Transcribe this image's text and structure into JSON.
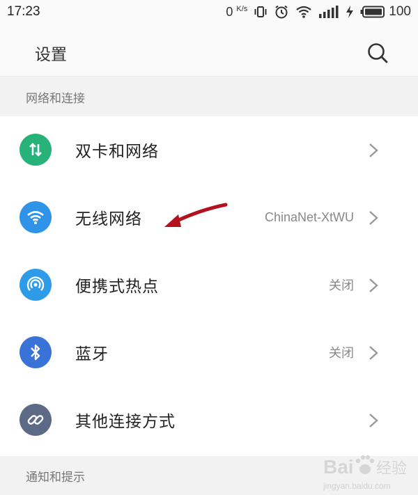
{
  "status_bar": {
    "time": "17:23",
    "net_speed": "0",
    "net_speed_unit": "K/s",
    "battery_level": "100"
  },
  "header": {
    "title": "设置",
    "search_icon": "search-icon"
  },
  "sections": {
    "network": "网络和连接",
    "notifications": "通知和提示"
  },
  "items": [
    {
      "label": "双卡和网络",
      "value": "",
      "icon": "dual-sim-icon",
      "color": "#27b279"
    },
    {
      "label": "无线网络",
      "value": "ChinaNet-XtWU",
      "icon": "wifi-icon",
      "color": "#2f94e8"
    },
    {
      "label": "便携式热点",
      "value": "关闭",
      "icon": "hotspot-icon",
      "color": "#2e9be8"
    },
    {
      "label": "蓝牙",
      "value": "关闭",
      "icon": "bluetooth-icon",
      "color": "#3a73d8"
    },
    {
      "label": "其他连接方式",
      "value": "",
      "icon": "link-icon",
      "color": "#5c6a86"
    }
  ],
  "colors": {
    "arrow": "#b3121c",
    "watermark": "#d9d9d9"
  },
  "watermark": {
    "brand": "Baidu经验",
    "url": "jingyan.baidu.com"
  }
}
